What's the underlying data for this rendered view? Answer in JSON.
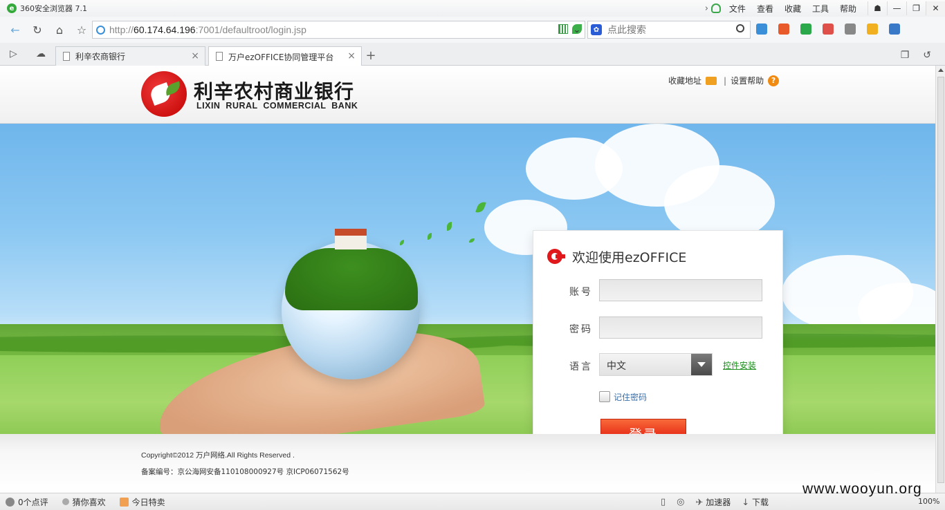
{
  "browser": {
    "title": "360安全浏览器 7.1",
    "menu": [
      "文件",
      "查看",
      "收藏",
      "工具",
      "帮助"
    ],
    "url_prefix": "http://",
    "url_host": "60.174.64.196",
    "url_rest": ":7001/defaultroot/login.jsp",
    "search_placeholder": "点此搜索",
    "tabs": [
      {
        "label": "利辛农商银行",
        "active": false
      },
      {
        "label": "万户ezOFFICE协同管理平台",
        "active": true
      }
    ],
    "new_tab": "+"
  },
  "header": {
    "bank_name_cn": "利辛农村商业银行",
    "bank_name_en": "LIXIN RURAL COMMERCIAL BANK",
    "favorites_link": "收藏地址",
    "separator": "|",
    "settings_help_link": "设置帮助",
    "help_icon_glyph": "?"
  },
  "login": {
    "title": "欢迎使用ezOFFICE",
    "account_label": "账号",
    "account_value": "",
    "password_label": "密码",
    "password_value": "",
    "language_label": "语言",
    "language_selected": "中文",
    "plugin_install_link": "控件安装",
    "remember_label": "记住密码",
    "remember_checked": false,
    "login_button": "登录"
  },
  "footer": {
    "copyright": "Copyright©2012 万户网络.All Rights Reserved .",
    "icp": "备案编号：京公海网安备110108000927号 京ICP06071562号"
  },
  "statusbar": {
    "comments": "0个点评",
    "guess_like": "猜你喜欢",
    "daily_deal": "今日特卖",
    "accelerator": "加速器",
    "download": "下载",
    "zoom": "100%"
  },
  "watermark": "www.wooyun.org",
  "colors": {
    "brand_red": "#e0181b",
    "login_button": "#e8321a",
    "plugin_link": "#1a8c1a",
    "sky": "#8cc8f2",
    "grass": "#8fcf58"
  }
}
